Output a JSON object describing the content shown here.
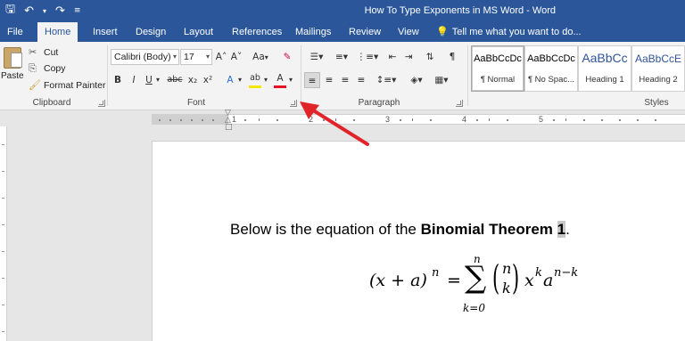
{
  "titlebar": {
    "title": "How To Type Exponents in MS Word - Word",
    "save_icon": "save-icon",
    "undo_icon": "undo-icon",
    "redo_icon": "redo-icon",
    "customize_icon": "customize-qat-icon"
  },
  "tabs": {
    "file": "File",
    "home": "Home",
    "insert": "Insert",
    "design": "Design",
    "layout": "Layout",
    "references": "References",
    "mailings": "Mailings",
    "review": "Review",
    "view": "View",
    "tell_me": "Tell me what you want to do..."
  },
  "clipboard": {
    "paste": "Paste",
    "cut": "Cut",
    "copy": "Copy",
    "format_painter": "Format Painter",
    "label": "Clipboard"
  },
  "font": {
    "font_name": "Calibri (Body)",
    "font_size": "17",
    "grow": "A˄",
    "shrink": "A˅",
    "change_case": "Aa",
    "bold": "B",
    "italic": "I",
    "underline": "U",
    "strikethrough": "abc",
    "subscript": "x₂",
    "superscript": "x²",
    "text_effects": "A",
    "highlight": "ab",
    "font_color": "A",
    "label": "Font"
  },
  "paragraph": {
    "label": "Paragraph"
  },
  "styles": {
    "label": "Styles",
    "items": [
      {
        "sample": "AaBbCcDc",
        "name": "¶ Normal"
      },
      {
        "sample": "AaBbCcDc",
        "name": "¶ No Spac..."
      },
      {
        "sample": "AaBbCc",
        "name": "Heading 1"
      },
      {
        "sample": "AaBbCcE",
        "name": "Heading 2"
      }
    ]
  },
  "ruler": {
    "numbers": [
      "1",
      "2",
      "3",
      "4",
      "5"
    ]
  },
  "document": {
    "text_before": "Below is the equation of the ",
    "bold_text": "Binomial Theorem ",
    "selected_char": "1",
    "text_after": ".",
    "equation": {
      "lhs": "(x + a)",
      "lhs_exp": "n",
      "equals": "=",
      "sigma": "∑",
      "sum_upper": "n",
      "sum_lower": "k=0",
      "binom_top": "n",
      "binom_bottom": "k",
      "x": "x",
      "x_exp": "k",
      "a": "a",
      "a_exp": "n−k"
    }
  },
  "colors": {
    "title_bar": "#2b579a",
    "ribbon": "#f3f3f3",
    "annotation_arrow": "#e0242a",
    "font_color_bar": "#e81123",
    "highlight_bar": "#f5e800"
  }
}
